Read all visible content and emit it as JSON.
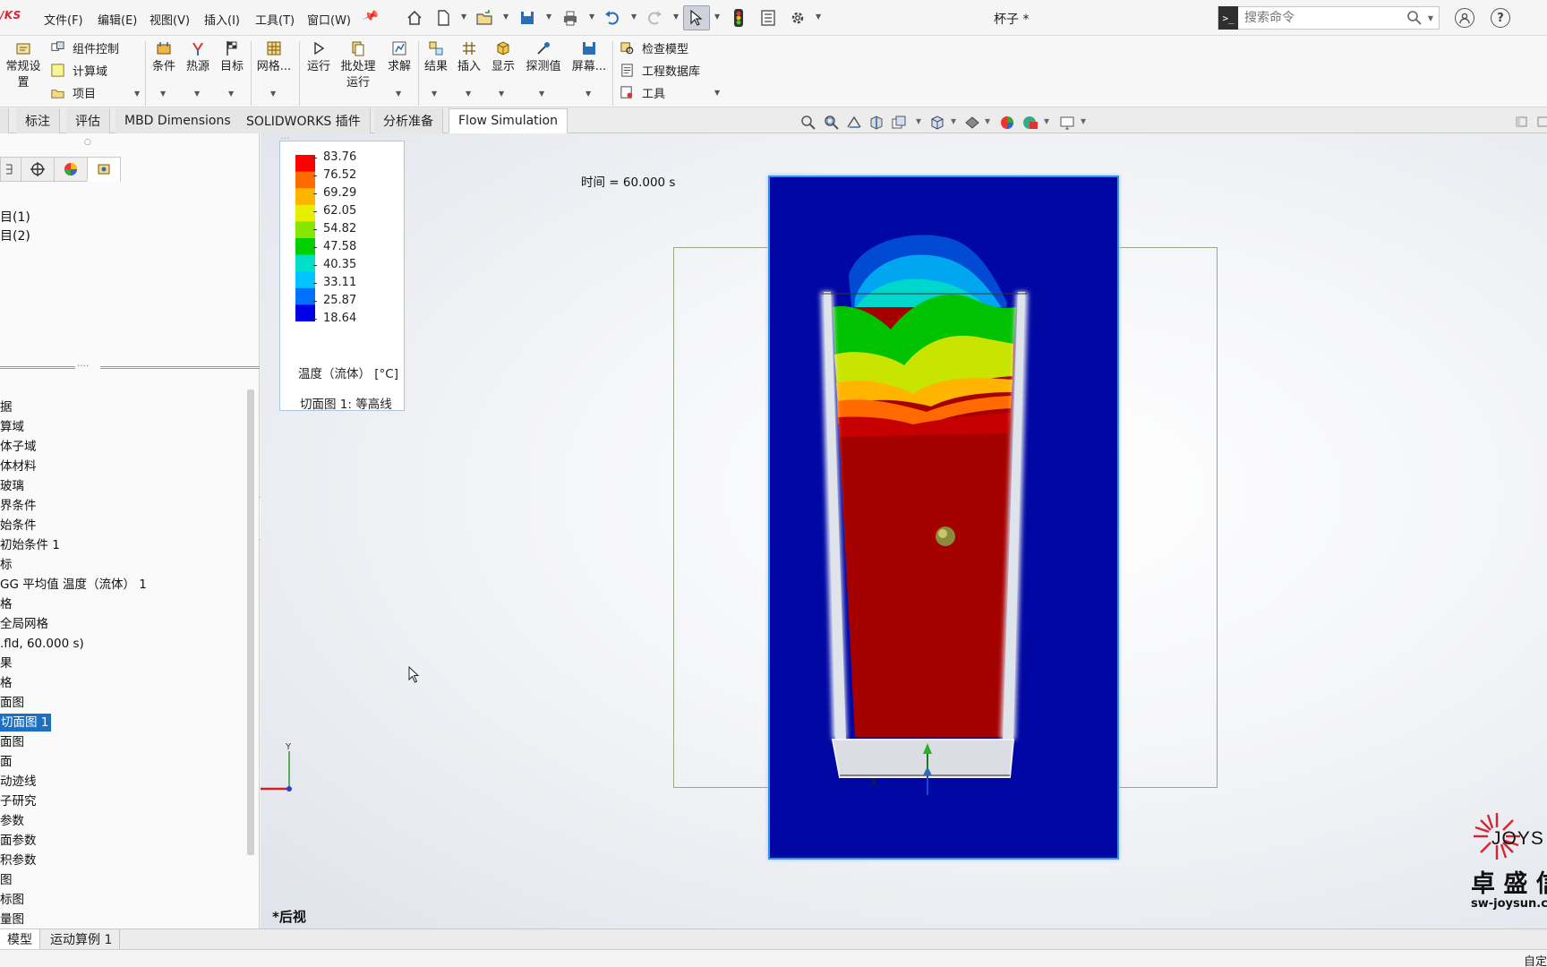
{
  "app": {
    "logo_text": "/KS",
    "document_title": "杯子 *"
  },
  "menu": [
    "文件(F)",
    "编辑(E)",
    "视图(V)",
    "插入(I)",
    "工具(T)",
    "窗口(W)"
  ],
  "search": {
    "placeholder": "搜索命令"
  },
  "ribbon": {
    "general_settings": "常规设\n置",
    "component_control": "组件控制",
    "computational_domain": "计算域",
    "project": "项目",
    "condition": "条件",
    "heat_source": "热源",
    "goal": "目标",
    "mesh": "网格...",
    "run": "运行",
    "batch_run": "批处理\n运行",
    "solve": "求解",
    "results": "结果",
    "insert": "插入",
    "display": "显示",
    "probe": "探测值",
    "screen": "屏幕...",
    "check_model": "检查模型",
    "engineering_db": "工程数据库",
    "tools": "工具"
  },
  "command_tabs": [
    {
      "label": "标注",
      "active": false
    },
    {
      "label": "评估",
      "active": false
    },
    {
      "label": "MBD Dimensions",
      "active": false
    },
    {
      "label": "SOLIDWORKS 插件",
      "active": false
    },
    {
      "label": "分析准备",
      "active": false
    },
    {
      "label": "Flow Simulation",
      "active": true
    }
  ],
  "left_pane": {
    "upper_items": [
      "目(1)",
      "目(2)"
    ],
    "tree": [
      "据",
      "算域",
      "体子域",
      "体材料",
      "玻璃",
      "界条件",
      "始条件",
      "初始条件 1",
      "标",
      "GG 平均值 温度（流体） 1",
      "格",
      "全局网格",
      ".fld, 60.000 s)",
      "果",
      "格",
      "面图",
      "切面图 1",
      "面图",
      "面",
      "动迹线",
      "子研究",
      "参数",
      "面参数",
      "积参数",
      "图",
      "标图",
      "量图"
    ],
    "selected_index": 16
  },
  "legend": {
    "values": [
      "83.76",
      "76.52",
      "69.29",
      "62.05",
      "54.82",
      "47.58",
      "40.35",
      "33.11",
      "25.87",
      "18.64"
    ],
    "colors": [
      "#ff0000",
      "#ff6a00",
      "#ffb400",
      "#e8ee00",
      "#86e600",
      "#00d000",
      "#00e0c8",
      "#00c4ff",
      "#0070ff",
      "#0000e6"
    ],
    "title": "温度（流体） [°C]",
    "plot_name": "切面图 1: 等高线"
  },
  "viewport": {
    "time_label": "时间 = 60.000 s",
    "view_name": "*后视",
    "triad_y": "Y",
    "triad_x": "X"
  },
  "watermark": {
    "brand": "JOYS",
    "cn": "卓 盛 信",
    "url": "sw-joysun.c"
  },
  "bottom_tabs": [
    {
      "label": "模型",
      "active": true
    },
    {
      "label": "运动算例 1",
      "active": false
    }
  ],
  "status": {
    "right": "自定"
  }
}
